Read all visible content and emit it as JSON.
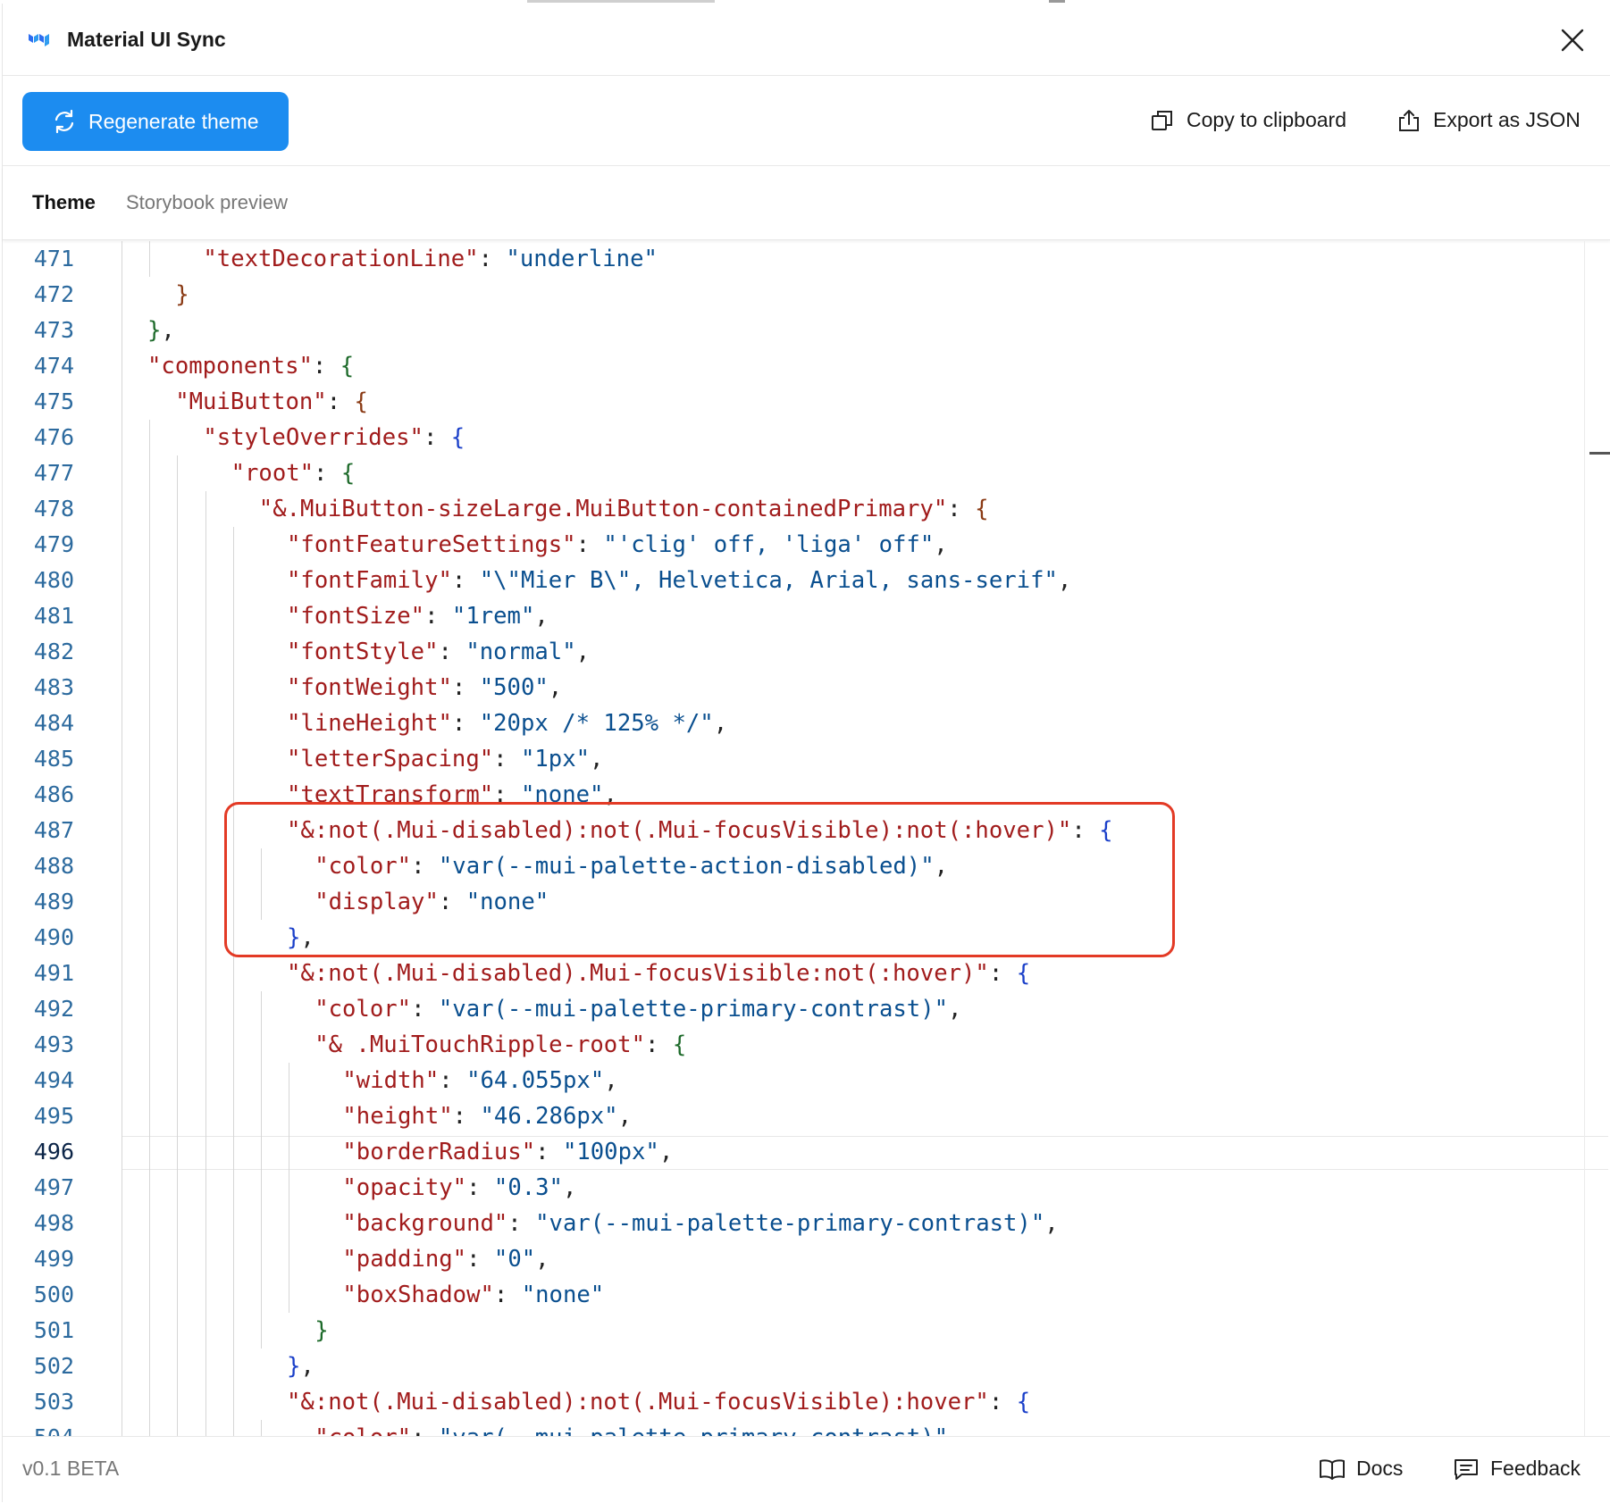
{
  "window": {
    "title": "Material UI Sync",
    "logo_icon": "material-ui-logo-icon",
    "close_icon": "close-icon"
  },
  "toolbar": {
    "regenerate_label": "Regenerate theme",
    "regenerate_icon": "refresh-icon",
    "copy_label": "Copy to clipboard",
    "copy_icon": "copy-icon",
    "export_label": "Export as JSON",
    "export_icon": "export-icon",
    "accent": "#1c8cf0"
  },
  "tabs": [
    {
      "label": "Theme",
      "active": true
    },
    {
      "label": "Storybook preview",
      "active": false
    }
  ],
  "editor": {
    "current_line": 496,
    "highlight_color": "#e33a25",
    "lines": [
      {
        "n": "471",
        "indent": 2,
        "t": [
          [
            "k",
            "\"textDecorationLine\""
          ],
          [
            "p",
            ": "
          ],
          [
            "s",
            "\"underline\""
          ]
        ]
      },
      {
        "n": "472",
        "indent": 1,
        "t": [
          [
            "b3",
            "}"
          ]
        ]
      },
      {
        "n": "473",
        "indent": 0,
        "t": [
          [
            "b1",
            "}"
          ],
          [
            "p",
            ","
          ]
        ]
      },
      {
        "n": "474",
        "indent": 0,
        "t": [
          [
            "k",
            "\"components\""
          ],
          [
            "p",
            ": "
          ],
          [
            "b1",
            "{"
          ]
        ]
      },
      {
        "n": "475",
        "indent": 1,
        "t": [
          [
            "k",
            "\"MuiButton\""
          ],
          [
            "p",
            ": "
          ],
          [
            "b3",
            "{"
          ]
        ]
      },
      {
        "n": "476",
        "indent": 2,
        "t": [
          [
            "k",
            "\"styleOverrides\""
          ],
          [
            "p",
            ": "
          ],
          [
            "b2",
            "{"
          ]
        ]
      },
      {
        "n": "477",
        "indent": 3,
        "t": [
          [
            "k",
            "\"root\""
          ],
          [
            "p",
            ": "
          ],
          [
            "b1",
            "{"
          ]
        ]
      },
      {
        "n": "478",
        "indent": 4,
        "t": [
          [
            "k",
            "\"&.MuiButton-sizeLarge.MuiButton-containedPrimary\""
          ],
          [
            "p",
            ": "
          ],
          [
            "b3",
            "{"
          ]
        ]
      },
      {
        "n": "479",
        "indent": 5,
        "t": [
          [
            "k",
            "\"fontFeatureSettings\""
          ],
          [
            "p",
            ": "
          ],
          [
            "s",
            "\"'clig' off, 'liga' off\""
          ],
          [
            "p",
            ","
          ]
        ]
      },
      {
        "n": "480",
        "indent": 5,
        "t": [
          [
            "k",
            "\"fontFamily\""
          ],
          [
            "p",
            ": "
          ],
          [
            "s",
            "\"\\\"Mier B\\\", Helvetica, Arial, sans-serif\""
          ],
          [
            "p",
            ","
          ]
        ]
      },
      {
        "n": "481",
        "indent": 5,
        "t": [
          [
            "k",
            "\"fontSize\""
          ],
          [
            "p",
            ": "
          ],
          [
            "s",
            "\"1rem\""
          ],
          [
            "p",
            ","
          ]
        ]
      },
      {
        "n": "482",
        "indent": 5,
        "t": [
          [
            "k",
            "\"fontStyle\""
          ],
          [
            "p",
            ": "
          ],
          [
            "s",
            "\"normal\""
          ],
          [
            "p",
            ","
          ]
        ]
      },
      {
        "n": "483",
        "indent": 5,
        "t": [
          [
            "k",
            "\"fontWeight\""
          ],
          [
            "p",
            ": "
          ],
          [
            "s",
            "\"500\""
          ],
          [
            "p",
            ","
          ]
        ]
      },
      {
        "n": "484",
        "indent": 5,
        "t": [
          [
            "k",
            "\"lineHeight\""
          ],
          [
            "p",
            ": "
          ],
          [
            "s",
            "\"20px /* 125% */\""
          ],
          [
            "p",
            ","
          ]
        ]
      },
      {
        "n": "485",
        "indent": 5,
        "t": [
          [
            "k",
            "\"letterSpacing\""
          ],
          [
            "p",
            ": "
          ],
          [
            "s",
            "\"1px\""
          ],
          [
            "p",
            ","
          ]
        ]
      },
      {
        "n": "486",
        "indent": 5,
        "t": [
          [
            "k",
            "\"textTransform\""
          ],
          [
            "p",
            ": "
          ],
          [
            "s",
            "\"none\""
          ],
          [
            "p",
            ","
          ]
        ]
      },
      {
        "n": "487",
        "indent": 5,
        "t": [
          [
            "k",
            "\"&:not(.Mui-disabled):not(.Mui-focusVisible):not(:hover)\""
          ],
          [
            "p",
            ": "
          ],
          [
            "b2",
            "{"
          ]
        ]
      },
      {
        "n": "488",
        "indent": 6,
        "t": [
          [
            "k",
            "\"color\""
          ],
          [
            "p",
            ": "
          ],
          [
            "s",
            "\"var(--mui-palette-action-disabled)\""
          ],
          [
            "p",
            ","
          ]
        ]
      },
      {
        "n": "489",
        "indent": 6,
        "t": [
          [
            "k",
            "\"display\""
          ],
          [
            "p",
            ": "
          ],
          [
            "s",
            "\"none\""
          ]
        ]
      },
      {
        "n": "490",
        "indent": 5,
        "t": [
          [
            "b2",
            "}"
          ],
          [
            "p",
            ","
          ]
        ]
      },
      {
        "n": "491",
        "indent": 5,
        "t": [
          [
            "k",
            "\"&:not(.Mui-disabled).Mui-focusVisible:not(:hover)\""
          ],
          [
            "p",
            ": "
          ],
          [
            "b2",
            "{"
          ]
        ]
      },
      {
        "n": "492",
        "indent": 6,
        "t": [
          [
            "k",
            "\"color\""
          ],
          [
            "p",
            ": "
          ],
          [
            "s",
            "\"var(--mui-palette-primary-contrast)\""
          ],
          [
            "p",
            ","
          ]
        ]
      },
      {
        "n": "493",
        "indent": 6,
        "t": [
          [
            "k",
            "\"& .MuiTouchRipple-root\""
          ],
          [
            "p",
            ": "
          ],
          [
            "b1",
            "{"
          ]
        ]
      },
      {
        "n": "494",
        "indent": 7,
        "t": [
          [
            "k",
            "\"width\""
          ],
          [
            "p",
            ": "
          ],
          [
            "s",
            "\"64.055px\""
          ],
          [
            "p",
            ","
          ]
        ]
      },
      {
        "n": "495",
        "indent": 7,
        "t": [
          [
            "k",
            "\"height\""
          ],
          [
            "p",
            ": "
          ],
          [
            "s",
            "\"46.286px\""
          ],
          [
            "p",
            ","
          ]
        ]
      },
      {
        "n": "496",
        "indent": 7,
        "t": [
          [
            "k",
            "\"borderRadius\""
          ],
          [
            "p",
            ": "
          ],
          [
            "s",
            "\"100px\""
          ],
          [
            "p",
            ","
          ]
        ]
      },
      {
        "n": "497",
        "indent": 7,
        "t": [
          [
            "k",
            "\"opacity\""
          ],
          [
            "p",
            ": "
          ],
          [
            "s",
            "\"0.3\""
          ],
          [
            "p",
            ","
          ]
        ]
      },
      {
        "n": "498",
        "indent": 7,
        "t": [
          [
            "k",
            "\"background\""
          ],
          [
            "p",
            ": "
          ],
          [
            "s",
            "\"var(--mui-palette-primary-contrast)\""
          ],
          [
            "p",
            ","
          ]
        ]
      },
      {
        "n": "499",
        "indent": 7,
        "t": [
          [
            "k",
            "\"padding\""
          ],
          [
            "p",
            ": "
          ],
          [
            "s",
            "\"0\""
          ],
          [
            "p",
            ","
          ]
        ]
      },
      {
        "n": "500",
        "indent": 7,
        "t": [
          [
            "k",
            "\"boxShadow\""
          ],
          [
            "p",
            ": "
          ],
          [
            "s",
            "\"none\""
          ]
        ]
      },
      {
        "n": "501",
        "indent": 6,
        "t": [
          [
            "b1",
            "}"
          ]
        ]
      },
      {
        "n": "502",
        "indent": 5,
        "t": [
          [
            "b2",
            "}"
          ],
          [
            "p",
            ","
          ]
        ]
      },
      {
        "n": "503",
        "indent": 5,
        "t": [
          [
            "k",
            "\"&:not(.Mui-disabled):not(.Mui-focusVisible):hover\""
          ],
          [
            "p",
            ": "
          ],
          [
            "b2",
            "{"
          ]
        ]
      },
      {
        "n": "504",
        "indent": 6,
        "t": [
          [
            "k",
            "\"color\""
          ],
          [
            "p",
            ": "
          ],
          [
            "s",
            "\"var(--mui-palette-primary-contrast)\""
          ]
        ]
      }
    ]
  },
  "footer": {
    "version": "v0.1 BETA",
    "docs_label": "Docs",
    "docs_icon": "book-icon",
    "feedback_label": "Feedback",
    "feedback_icon": "feedback-icon"
  }
}
